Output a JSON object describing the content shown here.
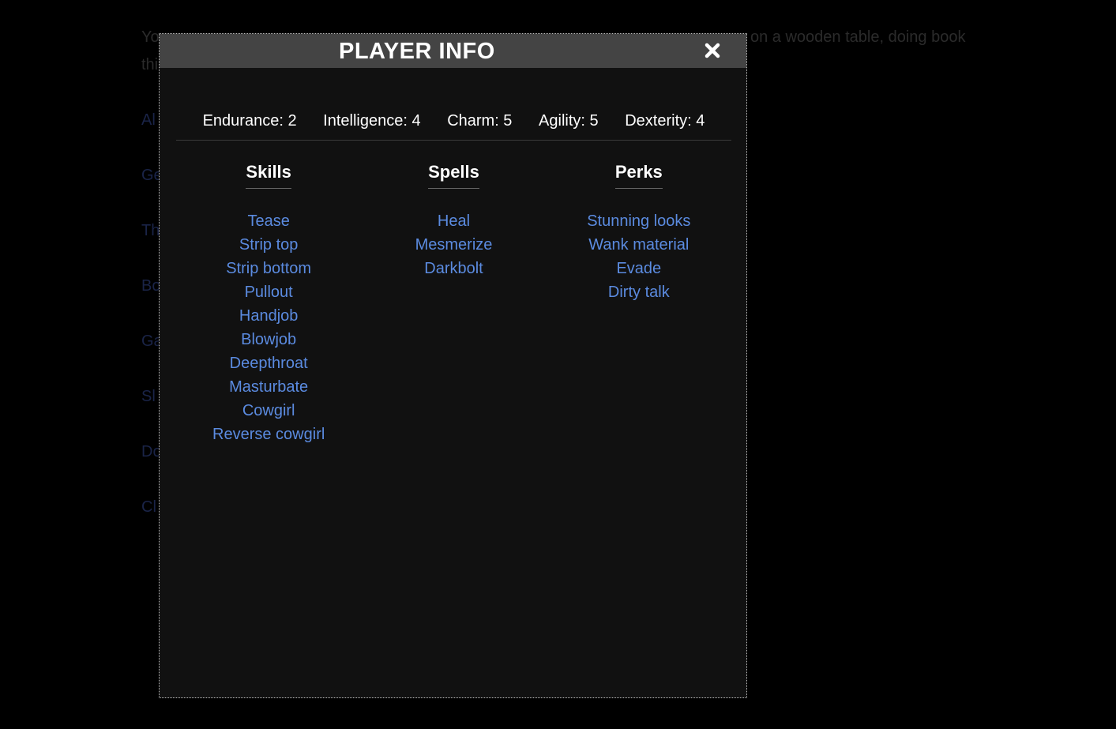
{
  "background": {
    "line1_start": "Yo",
    "line1_end": "on a wooden table, doing book",
    "line2_start": "thi",
    "side_letters": [
      "Al",
      "Ge",
      "Th",
      "Bo",
      "Ga",
      "Sl",
      "Do",
      "Cl"
    ]
  },
  "modal": {
    "title": "PLAYER INFO",
    "close_icon": "close-x-icon",
    "stats": [
      {
        "label": "Endurance: 2"
      },
      {
        "label": "Intelligence: 4"
      },
      {
        "label": "Charm: 5"
      },
      {
        "label": "Agility: 5"
      },
      {
        "label": "Dexterity: 4"
      }
    ],
    "skills": {
      "heading": "Skills",
      "items": [
        "Tease",
        "Strip top",
        "Strip bottom",
        "Pullout",
        "Handjob",
        "Blowjob",
        "Deepthroat",
        "Masturbate",
        "Cowgirl",
        "Reverse cowgirl"
      ]
    },
    "spells": {
      "heading": "Spells",
      "items": [
        "Heal",
        "Mesmerize",
        "Darkbolt"
      ]
    },
    "perks": {
      "heading": "Perks",
      "items": [
        "Stunning looks",
        "Wank material",
        "Evade",
        "Dirty talk"
      ]
    }
  },
  "colors": {
    "background": "#000000",
    "modal_bg": "#111111",
    "header_bg": "#444444",
    "link": "#5b8be0",
    "text": "#ffffff"
  }
}
